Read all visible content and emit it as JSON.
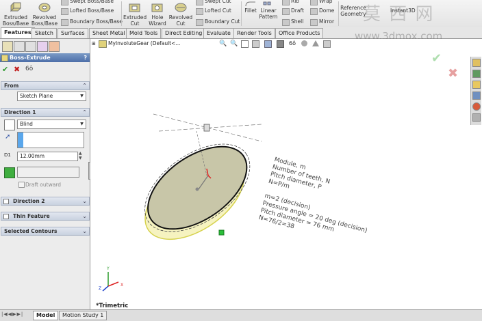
{
  "ribbon": {
    "extruded_boss": "Extruded Boss/Base",
    "revolved_boss": "Revolved Boss/Base",
    "swept_boss": "Swept Boss/Base",
    "lofted_boss": "Lofted Boss/Base",
    "boundary_boss": "Boundary Boss/Base",
    "extruded_cut": "Extruded Cut",
    "hole_wizard": "Hole Wizard",
    "revolved_cut": "Revolved Cut",
    "swept_cut": "Swept Cut",
    "lofted_cut": "Lofted Cut",
    "boundary_cut": "Boundary Cut",
    "fillet": "Fillet",
    "linear_pattern": "Linear Pattern",
    "rib": "Rib",
    "draft": "Draft",
    "shell": "Shell",
    "wrap": "Wrap",
    "dome": "Dome",
    "mirror": "Mirror",
    "reference_geometry": "Reference Geometry",
    "instant3d": "Instant3D"
  },
  "watermark": {
    "chars": "莫 西 网",
    "url": "www.3dmox.com"
  },
  "tabs": [
    "Features",
    "Sketch",
    "Surfaces",
    "Sheet Metal",
    "Mold Tools",
    "Direct Editing",
    "Evaluate",
    "Render Tools",
    "Office Products"
  ],
  "panel": {
    "title": "Boss-Extrude",
    "help": "?",
    "from_label": "From",
    "from_value": "Sketch Plane",
    "direction1_label": "Direction 1",
    "end_condition": "Blind",
    "depth_value": "12.00mm",
    "draft_outward": "Draft outward",
    "direction2_label": "Direction 2",
    "thin_feature_label": "Thin Feature",
    "selected_contours_label": "Selected Contours"
  },
  "tree": {
    "part_name": "MyInvoluteGear  (Default<..."
  },
  "notes": {
    "line1": "Module, m",
    "line2": "Number of teeth, N",
    "line3": "Pitch diameter, P",
    "line4": "N=P/m",
    "line5": "m=2 (decision)",
    "line6": "Pressure angle = 20 deg (decision)",
    "line7": "Pitch diameter = 76 mm",
    "line8": "N=76/2=38"
  },
  "view": {
    "orientation": "*Trimetric",
    "x_axis": "X",
    "y_axis": "Y",
    "z_axis": "Z"
  },
  "status": {
    "model_tab": "Model",
    "motion_tab": "Motion Study 1"
  }
}
